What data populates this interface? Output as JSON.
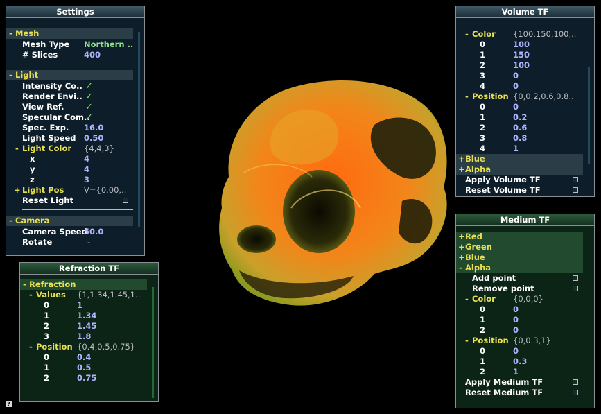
{
  "settings": {
    "title": "Settings",
    "mesh": {
      "header": "Mesh",
      "type_label": "Mesh Type",
      "type_value": "Northern ..",
      "slices_label": "# Slices",
      "slices_value": "400"
    },
    "light": {
      "header": "Light",
      "intensity": "Intensity Co..",
      "render_env": "Render Envi..",
      "view_ref": "View Ref.",
      "specular": "Specular Com..",
      "spec_exp_label": "Spec. Exp.",
      "spec_exp_value": "16.0",
      "speed_label": "Light Speed",
      "speed_value": "0.50",
      "color_label": "Light Color",
      "color_value": "{4,4,3}",
      "x_label": "x",
      "x_value": "4",
      "y_label": "y",
      "y_value": "4",
      "z_label": "z",
      "z_value": "3",
      "pos_label": "Light Pos",
      "pos_value": "V={0.00,..",
      "reset_label": "Reset Light"
    },
    "camera": {
      "header": "Camera",
      "speed_label": "Camera Speed",
      "speed_value": "50.0",
      "rotate_label": "Rotate",
      "rotate_value": "-"
    }
  },
  "refraction": {
    "title": "Refraction TF",
    "header": "Refraction",
    "values_label": "Values",
    "values_summary": "{1,1.34,1.45,1..",
    "values": [
      {
        "i": "0",
        "v": "1"
      },
      {
        "i": "1",
        "v": "1.34"
      },
      {
        "i": "2",
        "v": "1.45"
      },
      {
        "i": "3",
        "v": "1.8"
      }
    ],
    "position_label": "Position",
    "position_summary": "{0.4,0.5,0.75}",
    "positions": [
      {
        "i": "0",
        "v": "0.4"
      },
      {
        "i": "1",
        "v": "0.5"
      },
      {
        "i": "2",
        "v": "0.75"
      }
    ]
  },
  "volume": {
    "title": "Volume TF",
    "color_label": "Color",
    "color_summary": "{100,150,100,..",
    "colors": [
      {
        "i": "0",
        "v": "100"
      },
      {
        "i": "1",
        "v": "150"
      },
      {
        "i": "2",
        "v": "100"
      },
      {
        "i": "3",
        "v": "0"
      },
      {
        "i": "4",
        "v": "0"
      }
    ],
    "position_label": "Position",
    "position_summary": "{0,0.2,0.6,0.8..",
    "positions": [
      {
        "i": "0",
        "v": "0"
      },
      {
        "i": "1",
        "v": "0.2"
      },
      {
        "i": "2",
        "v": "0.6"
      },
      {
        "i": "3",
        "v": "0.8"
      },
      {
        "i": "4",
        "v": "1"
      }
    ],
    "blue": "Blue",
    "alpha": "Alpha",
    "apply": "Apply Volume TF",
    "reset": "Reset Volume TF"
  },
  "medium": {
    "title": "Medium TF",
    "red": "Red",
    "green": "Green",
    "blue": "Blue",
    "alpha": "Alpha",
    "add_point": "Add point",
    "remove_point": "Remove point",
    "color_label": "Color",
    "color_summary": "{0,0,0}",
    "colors": [
      {
        "i": "0",
        "v": "0"
      },
      {
        "i": "1",
        "v": "0"
      },
      {
        "i": "2",
        "v": "0"
      }
    ],
    "position_label": "Position",
    "position_summary": "{0,0.3,1}",
    "positions": [
      {
        "i": "0",
        "v": "0"
      },
      {
        "i": "1",
        "v": "0.3"
      },
      {
        "i": "2",
        "v": "1"
      }
    ],
    "apply": "Apply Medium TF",
    "reset": "Reset Medium TF"
  },
  "symbols": {
    "minus": "-",
    "plus": "+",
    "check": "✓",
    "help": "?"
  },
  "colors": {
    "accent_yellow": "#e8e050",
    "value_blue": "#b0b4ff",
    "value_green": "#8ee089",
    "check_green": "#7ee36a",
    "skull_orange": "#f07a18"
  }
}
